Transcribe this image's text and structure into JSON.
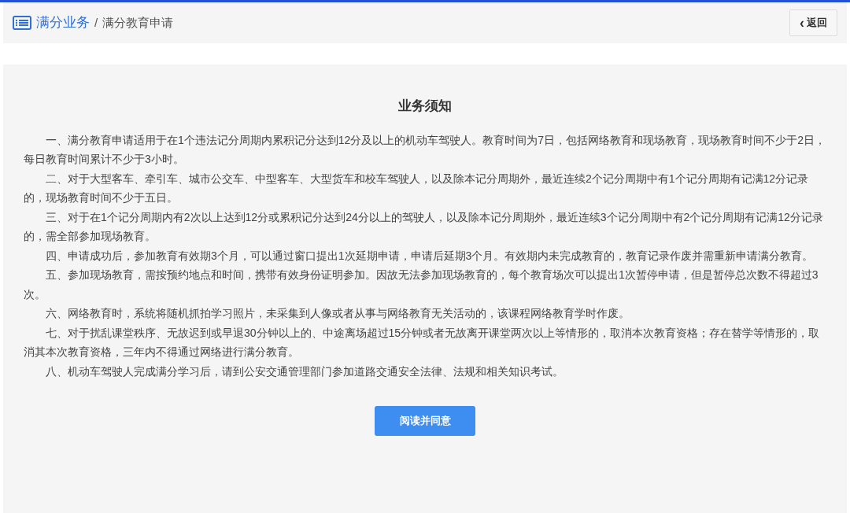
{
  "breadcrumb": {
    "parent": "满分业务",
    "separator": "/",
    "current": "满分教育申请"
  },
  "back_button": {
    "icon": "‹",
    "label": "返回"
  },
  "notice": {
    "title": "业务须知",
    "paragraphs": [
      "一、满分教育申请适用于在1个违法记分周期内累积记分达到12分及以上的机动车驾驶人。教育时间为7日，包括网络教育和现场教育，现场教育时间不少于2日，每日教育时间累计不少于3小时。",
      "二、对于大型客车、牵引车、城市公交车、中型客车、大型货车和校车驾驶人，以及除本记分周期外，最近连续2个记分周期中有1个记分周期有记满12分记录的，现场教育时间不少于五日。",
      "三、对于在1个记分周期内有2次以上达到12分或累积记分达到24分以上的驾驶人，以及除本记分周期外，最近连续3个记分周期中有2个记分周期有记满12分记录的，需全部参加现场教育。",
      "四、申请成功后，参加教育有效期3个月，可以通过窗口提出1次延期申请，申请后延期3个月。有效期内未完成教育的，教育记录作废并需重新申请满分教育。",
      "五、参加现场教育，需按预约地点和时间，携带有效身份证明参加。因故无法参加现场教育的，每个教育场次可以提出1次暂停申请，但是暂停总次数不得超过3次。",
      "六、网络教育时，系统将随机抓拍学习照片，未采集到人像或者从事与网络教育无关活动的，该课程网络教育学时作废。",
      "七、对于扰乱课堂秩序、无故迟到或早退30分钟以上的、中途离场超过15分钟或者无故离开课堂两次以上等情形的，取消本次教育资格；存在替学等情形的，取消其本次教育资格，三年内不得通过网络进行满分教育。",
      "八、机动车驾驶人完成满分学习后，请到公安交通管理部门参加道路交通安全法律、法规和相关知识考试。"
    ],
    "agree_button": "阅读并同意"
  }
}
